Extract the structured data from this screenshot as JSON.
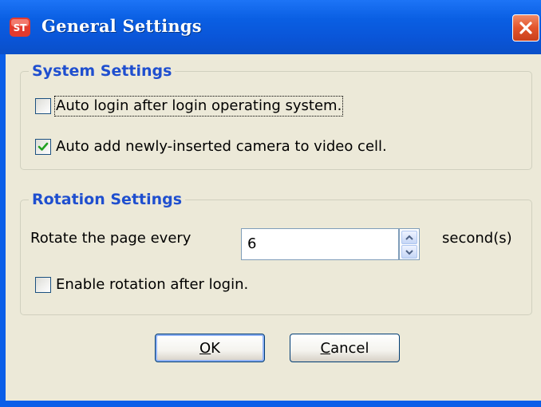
{
  "window": {
    "title": "General Settings",
    "app_icon_text": "ST",
    "close_icon": "close-icon"
  },
  "system_settings": {
    "title": "System Settings",
    "auto_login": {
      "label": "Auto login after login operating system.",
      "checked": false
    },
    "auto_add_camera": {
      "label": "Auto add newly-inserted camera to video cell.",
      "checked": true
    }
  },
  "rotation_settings": {
    "title": "Rotation Settings",
    "rotate_label": "Rotate the page every",
    "rotate_value": "6",
    "unit": "second(s)",
    "enable_rotation": {
      "label": "Enable rotation after login.",
      "checked": false
    }
  },
  "buttons": {
    "ok": {
      "mnemonic": "O",
      "rest": "K"
    },
    "cancel": {
      "mnemonic": "C",
      "rest": "ancel"
    }
  },
  "colors": {
    "titlebar": "#0a5ee8",
    "dialog_bg": "#ece9d8",
    "group_title": "#1f4fcf",
    "close_button": "#e2542b",
    "check_mark": "#21a121"
  }
}
